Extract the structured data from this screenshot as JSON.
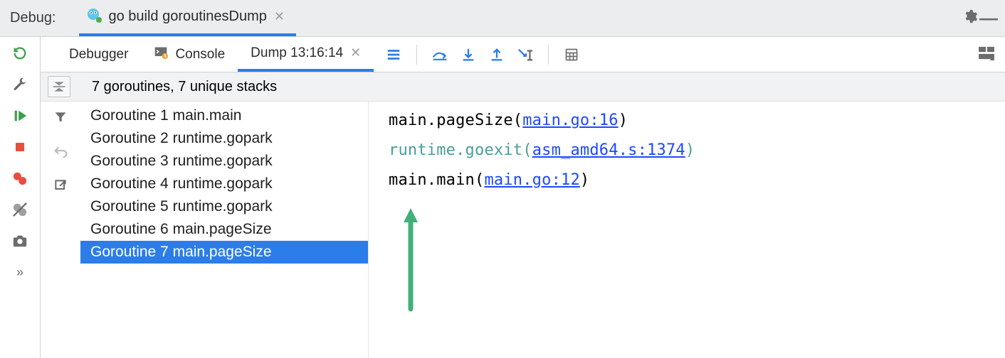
{
  "header": {
    "panel_label": "Debug:",
    "run_config_name": "go build goroutinesDump"
  },
  "tabs": {
    "debugger": "Debugger",
    "console": "Console",
    "dump_label": "Dump 13:16:14"
  },
  "summary": {
    "text": "7 goroutines, 7 unique stacks"
  },
  "goroutines": [
    "Goroutine 1 main.main",
    "Goroutine 2 runtime.gopark",
    "Goroutine 3 runtime.gopark",
    "Goroutine 4 runtime.gopark",
    "Goroutine 5 runtime.gopark",
    "Goroutine 6 main.pageSize",
    "Goroutine 7 main.pageSize"
  ],
  "goroutine_selected_index": 6,
  "stack_frames": [
    {
      "prefix": "main.pageSize(",
      "link": "main.go:16",
      "suffix": ")",
      "muted": false
    },
    {
      "prefix": "runtime.goexit(",
      "link": "asm_amd64.s:1374",
      "suffix": ")",
      "muted": true
    },
    {
      "prefix": "main.main(",
      "link": "main.go:12",
      "suffix": ")",
      "muted": false
    }
  ],
  "colors": {
    "accent": "#2b7de9",
    "link": "#1e49ff",
    "muted_lib": "#489e99"
  }
}
